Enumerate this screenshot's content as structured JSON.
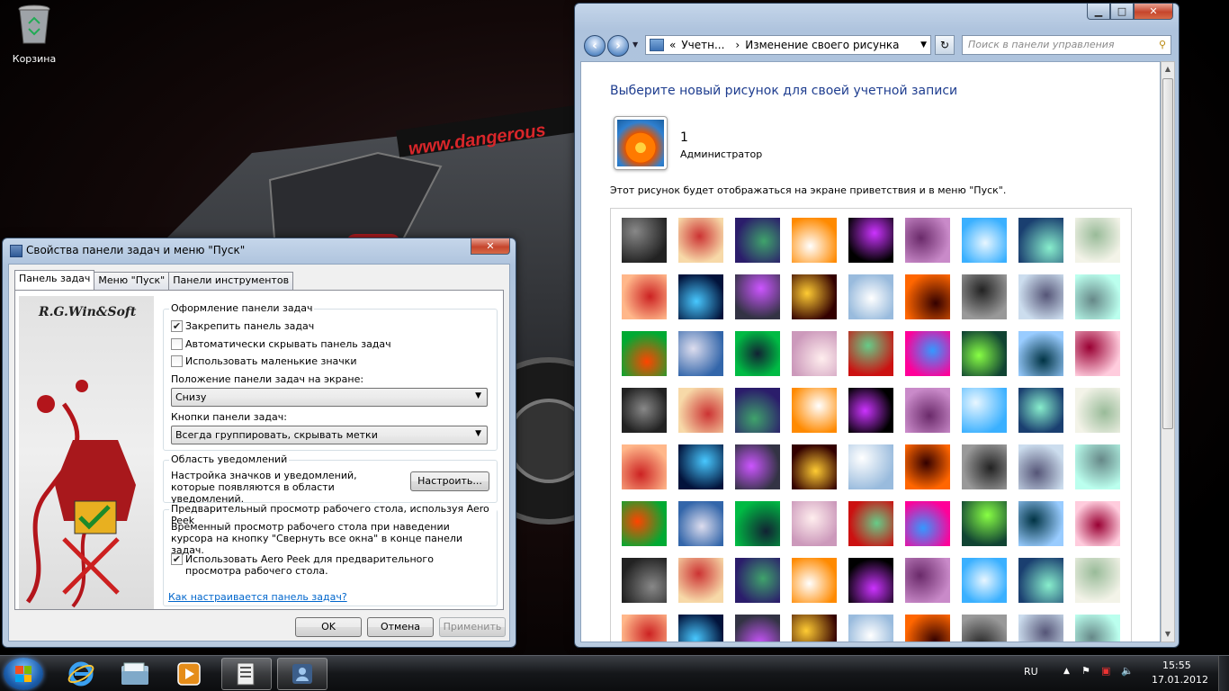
{
  "desktop": {
    "recycle_bin_label": "Корзина",
    "wallpaper_text": "www.dangerous"
  },
  "control_panel": {
    "address": {
      "prefix": "«",
      "crumb1": "Учетн...",
      "sep": "›",
      "crumb2": "Изменение своего рисунка"
    },
    "search_placeholder": "Поиск в панели управления",
    "heading": "Выберите новый рисунок для своей учетной записи",
    "user_name": "1",
    "user_role": "Администратор",
    "description": "Этот рисунок будет отображаться на экране приветствия и в меню \"Пуск\".",
    "picture_count": 72
  },
  "dialog": {
    "title": "Свойства панели задач и меню \"Пуск\"",
    "tabs": [
      "Панель задач",
      "Меню \"Пуск\"",
      "Панели инструментов"
    ],
    "side_image_text": "R.G.Win&Soft",
    "group1": {
      "title": "Оформление панели задач",
      "lock": {
        "label": "Закрепить панель задач",
        "checked": true
      },
      "autohide": {
        "label": "Автоматически скрывать панель задач",
        "checked": false
      },
      "small_icons": {
        "label": "Использовать маленькие значки",
        "checked": false
      },
      "position_label": "Положение панели задач на экране:",
      "position_value": "Снизу",
      "buttons_label": "Кнопки панели задач:",
      "buttons_value": "Всегда группировать, скрывать метки"
    },
    "group2": {
      "title": "Область уведомлений",
      "text": "Настройка значков и уведомлений, которые появляются в области уведомлений.",
      "button": "Настроить..."
    },
    "group3": {
      "title": "Предварительный просмотр рабочего стола, используя Aero Peek",
      "text": "Временный просмотр рабочего стола при наведении курсора на кнопку \"Свернуть все окна\" в конце панели задач.",
      "peek": {
        "label": "Использовать Aero Peek для предварительного просмотра рабочего стола.",
        "checked": true
      }
    },
    "help_link": "Как настраивается панель задач?",
    "ok": "OK",
    "cancel": "Отмена",
    "apply": "Применить"
  },
  "taskbar": {
    "language": "RU",
    "time": "15:55",
    "date": "17.01.2012"
  }
}
